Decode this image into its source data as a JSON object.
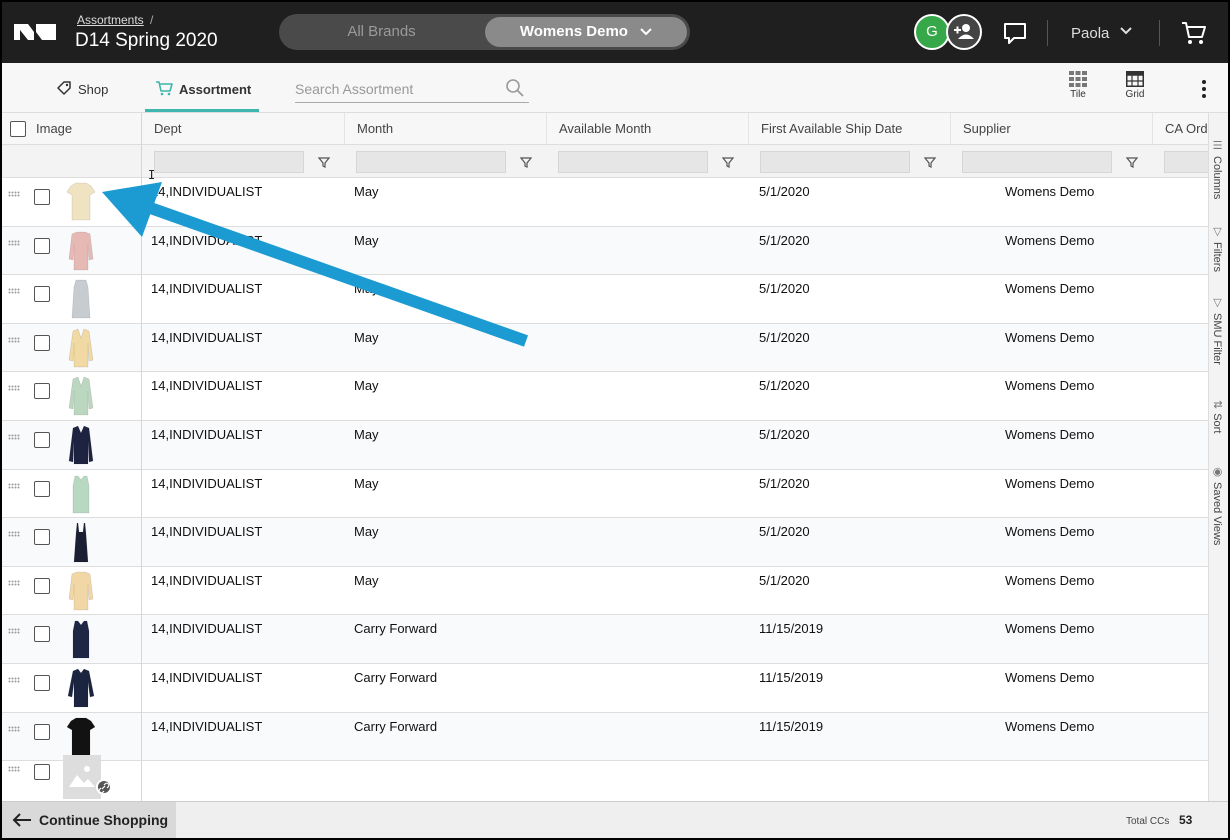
{
  "header": {
    "breadcrumb": "Assortments",
    "breadcrumb_separator": "/",
    "title": "D14 Spring 2020",
    "brand_toggle": {
      "all": "All Brands",
      "selected": "Womens Demo"
    },
    "avatar_initial": "G",
    "user_name": "Paola"
  },
  "toolbar": {
    "shop_label": "Shop",
    "assortment_label": "Assortment",
    "search_placeholder": "Search Assortment",
    "tile_label": "Tile",
    "grid_label": "Grid"
  },
  "columns": [
    "Image",
    "Dept",
    "Month",
    "Available Month",
    "First Available Ship Date",
    "Supplier",
    "CA Ord"
  ],
  "rows": [
    {
      "dept": "14,INDIVIDUALIST",
      "month": "May",
      "available_month": "",
      "ship_date": "5/1/2020",
      "supplier": "Womens Demo",
      "garment": "tee",
      "color": "#efe3c2"
    },
    {
      "dept": "14,INDIVIDUALIST",
      "month": "May",
      "available_month": "",
      "ship_date": "5/1/2020",
      "supplier": "Womens Demo",
      "garment": "sweater",
      "color": "#e7b9b5"
    },
    {
      "dept": "14,INDIVIDUALIST",
      "month": "May",
      "available_month": "",
      "ship_date": "5/1/2020",
      "supplier": "Womens Demo",
      "garment": "dress",
      "color": "#c7ccd1"
    },
    {
      "dept": "14,INDIVIDUALIST",
      "month": "May",
      "available_month": "",
      "ship_date": "5/1/2020",
      "supplier": "Womens Demo",
      "garment": "cardigan",
      "color": "#f0d9a2"
    },
    {
      "dept": "14,INDIVIDUALIST",
      "month": "May",
      "available_month": "",
      "ship_date": "5/1/2020",
      "supplier": "Womens Demo",
      "garment": "cardigan",
      "color": "#bcd7c0"
    },
    {
      "dept": "14,INDIVIDUALIST",
      "month": "May",
      "available_month": "",
      "ship_date": "5/1/2020",
      "supplier": "Womens Demo",
      "garment": "jacket",
      "color": "#1d2340"
    },
    {
      "dept": "14,INDIVIDUALIST",
      "month": "May",
      "available_month": "",
      "ship_date": "5/1/2020",
      "supplier": "Womens Demo",
      "garment": "tank",
      "color": "#b8d8c2"
    },
    {
      "dept": "14,INDIVIDUALIST",
      "month": "May",
      "available_month": "",
      "ship_date": "5/1/2020",
      "supplier": "Womens Demo",
      "garment": "slipdress",
      "color": "#1b1f33"
    },
    {
      "dept": "14,INDIVIDUALIST",
      "month": "May",
      "available_month": "",
      "ship_date": "5/1/2020",
      "supplier": "Womens Demo",
      "garment": "sweater",
      "color": "#f2d7a6"
    },
    {
      "dept": "14,INDIVIDUALIST",
      "month": "Carry Forward",
      "available_month": "",
      "ship_date": "11/15/2019",
      "supplier": "Womens Demo",
      "garment": "tank",
      "color": "#1e2744"
    },
    {
      "dept": "14,INDIVIDUALIST",
      "month": "Carry Forward",
      "available_month": "",
      "ship_date": "11/15/2019",
      "supplier": "Womens Demo",
      "garment": "shirt",
      "color": "#1c2540"
    },
    {
      "dept": "14,INDIVIDUALIST",
      "month": "Carry Forward",
      "available_month": "",
      "ship_date": "11/15/2019",
      "supplier": "Womens Demo",
      "garment": "tee",
      "color": "#121212"
    }
  ],
  "side_panel": [
    "Columns",
    "Filters",
    "SMU Filter",
    "Sort",
    "Saved Views"
  ],
  "footer": {
    "continue_label": "Continue Shopping",
    "total_label": "Total CCs",
    "total_value": "53"
  },
  "annotation": {
    "arrow_color": "#1b9bd1",
    "cursor_glyph": "I"
  },
  "colors": {
    "accent": "#3fb6ad",
    "avatar_green": "#36a84a",
    "topbar": "#1f1f1f"
  }
}
